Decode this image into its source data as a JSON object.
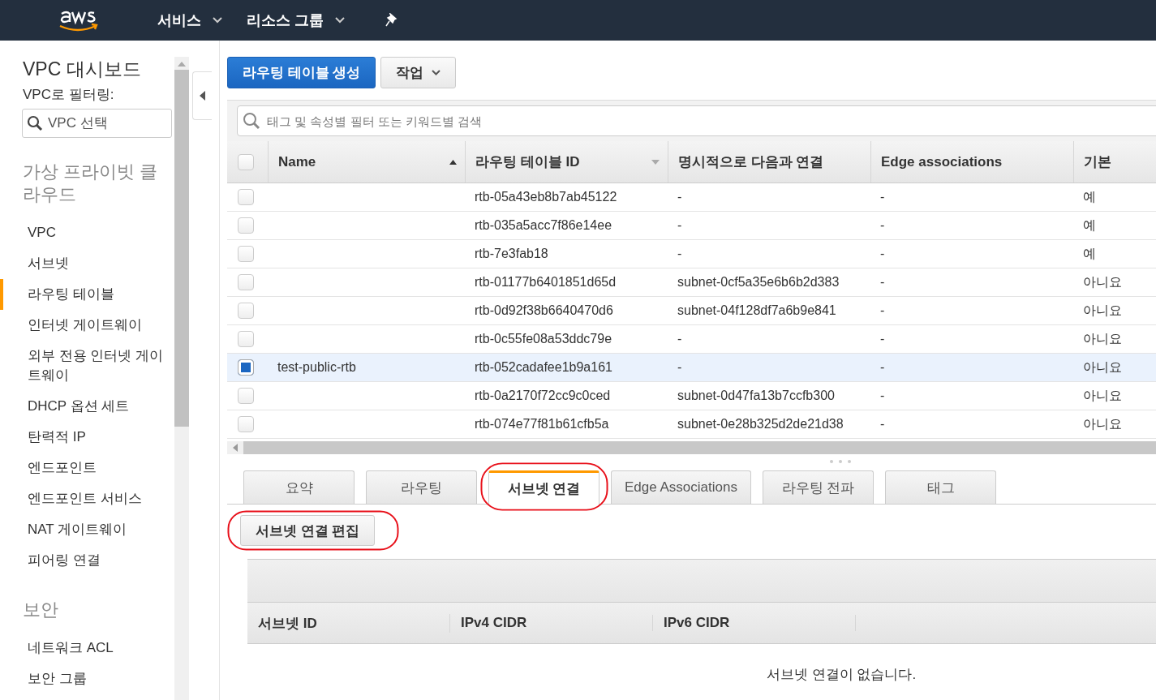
{
  "header": {
    "menus": [
      {
        "label": "서비스"
      },
      {
        "label": "리소스 그룹"
      }
    ]
  },
  "sidebar": {
    "title": "VPC 대시보드",
    "filter_label": "VPC로 필터링:",
    "filter": {
      "placeholder": "VPC 선택"
    },
    "entries": [
      {
        "kind": "heading",
        "label": "가상 프라이빗 클라우드"
      },
      {
        "kind": "item",
        "label": "VPC",
        "selected": false
      },
      {
        "kind": "item",
        "label": "서브넷",
        "selected": false
      },
      {
        "kind": "item",
        "label": "라우팅 테이블",
        "selected": true
      },
      {
        "kind": "item",
        "label": "인터넷 게이트웨이",
        "selected": false
      },
      {
        "kind": "item",
        "label": "외부 전용 인터넷 게이트웨이",
        "selected": false
      },
      {
        "kind": "item",
        "label": "DHCP 옵션 세트",
        "selected": false
      },
      {
        "kind": "item",
        "label": "탄력적 IP",
        "selected": false
      },
      {
        "kind": "item",
        "label": "엔드포인트",
        "selected": false
      },
      {
        "kind": "item",
        "label": "엔드포인트 서비스",
        "selected": false
      },
      {
        "kind": "item",
        "label": "NAT 게이트웨이",
        "selected": false
      },
      {
        "kind": "item",
        "label": "피어링 연결",
        "selected": false
      },
      {
        "kind": "heading",
        "label": "보안"
      },
      {
        "kind": "item",
        "label": "네트워크 ACL",
        "selected": false
      },
      {
        "kind": "item",
        "label": "보안 그룹",
        "selected": false
      }
    ]
  },
  "toolbar": {
    "create_button": "라우팅 테이블 생성",
    "actions_button": "작업"
  },
  "search": {
    "placeholder": "태그 및 속성별 필터 또는 키워드별 검색"
  },
  "table": {
    "all_selected": false,
    "columns": [
      {
        "label": "Name",
        "sorted": true
      },
      {
        "label": "라우팅 테이블 ID",
        "sorted": false
      },
      {
        "label": "명시적으로 다음과 연결"
      },
      {
        "label": "Edge associations"
      },
      {
        "label": "기본"
      }
    ],
    "rows": [
      {
        "selected": false,
        "id": "rtb-05a43eb8b7ab45122",
        "association": "-",
        "edge": "-",
        "main": "예"
      },
      {
        "selected": false,
        "id": "rtb-035a5acc7f86e14ee",
        "association": "-",
        "edge": "-",
        "main": "예"
      },
      {
        "selected": false,
        "id": "rtb-7e3fab18",
        "association": "-",
        "edge": "-",
        "main": "예"
      },
      {
        "selected": false,
        "id": "rtb-01177b6401851d65d",
        "association": "subnet-0cf5a35e6b6b2d383",
        "edge": "-",
        "main": "아니요"
      },
      {
        "selected": false,
        "id": "rtb-0d92f38b6640470d6",
        "association": "subnet-04f128df7a6b9e841",
        "edge": "-",
        "main": "아니요"
      },
      {
        "selected": false,
        "id": "rtb-0c55fe08a53ddc79e",
        "association": "-",
        "edge": "-",
        "main": "아니요"
      },
      {
        "selected": true,
        "name": "test-public-rtb",
        "id": "rtb-052cadafee1b9a161",
        "association": "-",
        "edge": "-",
        "main": "아니요"
      },
      {
        "selected": false,
        "id": "rtb-0a2170f72cc9c0ced",
        "association": "subnet-0d47fa13b7ccfb300",
        "edge": "-",
        "main": "아니요"
      },
      {
        "selected": false,
        "id": "rtb-074e77f81b61cfb5a",
        "association": "subnet-0e28b325d2de21d38",
        "edge": "-",
        "main": "아니요"
      }
    ]
  },
  "detail_tabs": [
    {
      "label": "요약",
      "selected": false,
      "annotated": false
    },
    {
      "label": "라우팅",
      "selected": false,
      "annotated": false
    },
    {
      "label": "서브넷 연결",
      "selected": true,
      "annotated": true
    },
    {
      "label": "Edge Associations",
      "selected": false,
      "annotated": false
    },
    {
      "label": "라우팅 전파",
      "selected": false,
      "annotated": false
    },
    {
      "label": "태그",
      "selected": false,
      "annotated": false
    }
  ],
  "edit_button": {
    "label": "서브넷 연결 편집",
    "annotated": true
  },
  "subnet_table": {
    "columns": [
      {
        "label": "서브넷 ID"
      },
      {
        "label": "IPv4 CIDR"
      },
      {
        "label": "IPv6 CIDR"
      }
    ],
    "empty_message": "서브넷 연결이 없습니다."
  }
}
